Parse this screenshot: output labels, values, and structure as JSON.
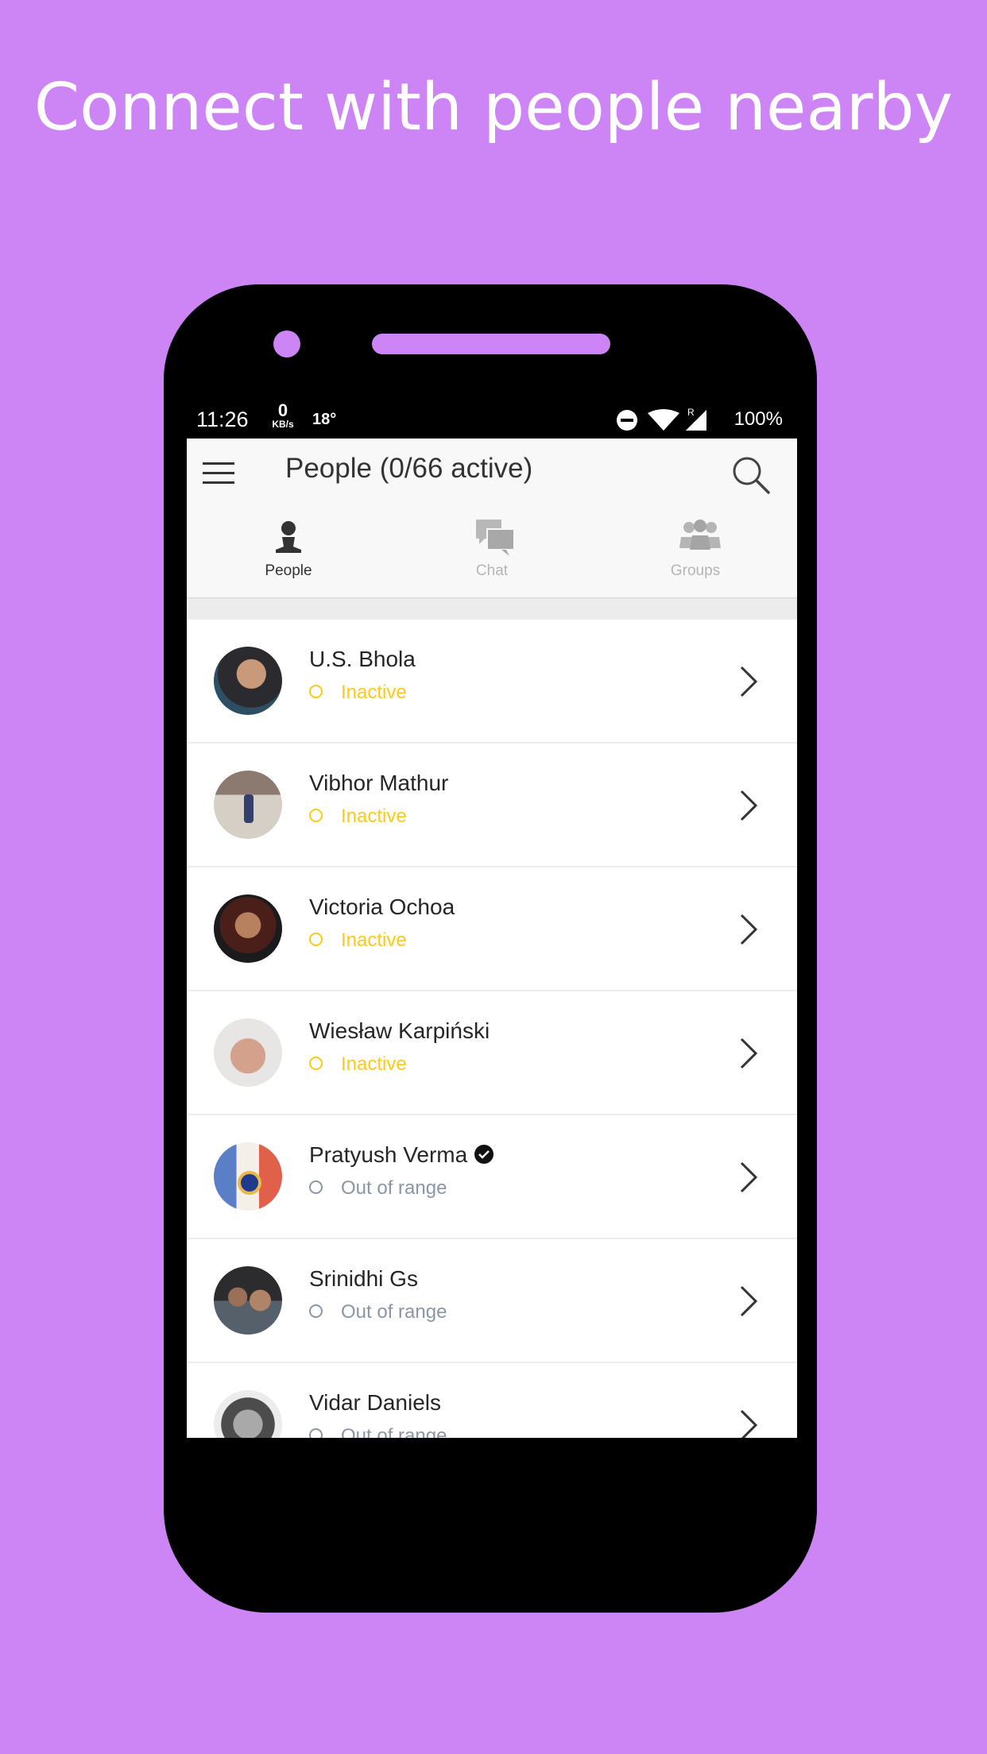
{
  "headline": "Connect with people nearby",
  "status_bar": {
    "time": "11:26",
    "kbs_value": "0",
    "kbs_unit": "KB/s",
    "temp": "18°",
    "roaming": "R",
    "battery": "100%"
  },
  "app_bar": {
    "title": "People (0/66 active)"
  },
  "tabs": [
    {
      "label": "People",
      "active": true
    },
    {
      "label": "Chat",
      "active": false
    },
    {
      "label": "Groups",
      "active": false
    }
  ],
  "people": [
    {
      "name": "U.S. Bhola",
      "status": "Inactive",
      "verified": false
    },
    {
      "name": "Vibhor Mathur",
      "status": "Inactive",
      "verified": false
    },
    {
      "name": "Victoria Ochoa",
      "status": "Inactive",
      "verified": false
    },
    {
      "name": "Wiesław Karpiński",
      "status": "Inactive",
      "verified": false
    },
    {
      "name": "Pratyush Verma",
      "status": "Out of range",
      "verified": true
    },
    {
      "name": "Srinidhi Gs",
      "status": "Out of range",
      "verified": false
    },
    {
      "name": "Vidar Daniels",
      "status": "Out of range",
      "verified": false
    }
  ],
  "colors": {
    "background": "#cd84f4",
    "inactive": "#ffc915",
    "out_of_range": "#8a96a6"
  }
}
